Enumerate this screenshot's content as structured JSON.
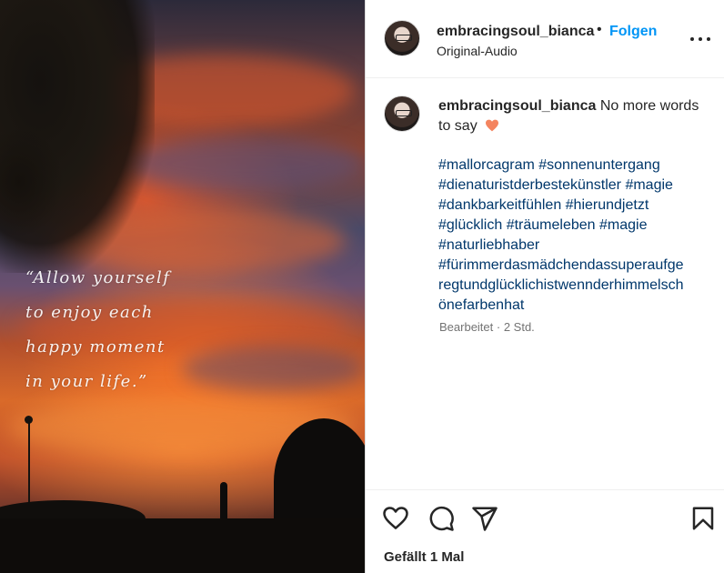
{
  "post": {
    "media": {
      "quote_lines": [
        "“Allow yourself",
        "to enjoy each",
        "happy moment",
        "in your life.”"
      ]
    },
    "header": {
      "username": "embracingsoul_bianca",
      "separator": "•",
      "follow_label": "Folgen",
      "audio_label": "Original-Audio",
      "more_icon": "more-horizontal-icon"
    },
    "caption": {
      "username": "embracingsoul_bianca",
      "text": "No more words to say",
      "emoji": "orange-heart",
      "hashtag_lines": [
        "#mallorcagram #sonnenuntergang",
        "#dienaturistderbestekünstler #magie",
        "#dankbarkeitfühlen #hierundjetzt",
        "#glücklich #träumeleben #magie",
        "#naturliebhaber",
        "#fürimmerdasmädchendassuperaufge",
        "regtundglücklichistwennderhimmelsch",
        "önefarbenhat"
      ],
      "meta": "Bearbeitet · 2 Std."
    },
    "actions": {
      "icons": [
        "heart-icon",
        "comment-icon",
        "share-icon",
        "bookmark-icon"
      ],
      "likes_label": "Gefällt 1 Mal"
    }
  },
  "colors": {
    "link_blue": "#0095f6",
    "hashtag": "#00376b",
    "text": "#262626",
    "muted": "#737373",
    "heart_emoji": "#f4845f"
  }
}
